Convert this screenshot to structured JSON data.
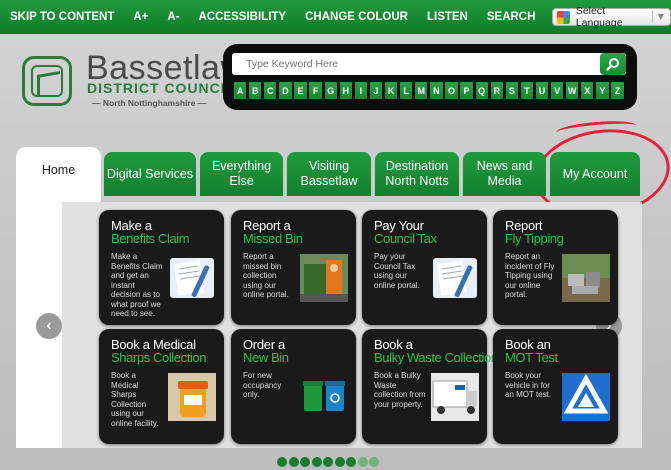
{
  "topbar": {
    "links": [
      "SKIP TO CONTENT",
      "A+",
      "A-",
      "ACCESSIBILITY",
      "CHANGE COLOUR",
      "LISTEN",
      "SEARCH"
    ],
    "language_label": "Select Language"
  },
  "logo": {
    "name": "Bassetlaw",
    "subtitle": "DISTRICT COUNCIL",
    "tagline": "— North Nottinghamshire —"
  },
  "search": {
    "placeholder": "Type Keyword Here",
    "letters": [
      "A",
      "B",
      "C",
      "D",
      "E",
      "F",
      "G",
      "H",
      "I",
      "J",
      "K",
      "L",
      "M",
      "N",
      "O",
      "P",
      "Q",
      "R",
      "S",
      "T",
      "U",
      "V",
      "W",
      "X",
      "Y",
      "Z"
    ]
  },
  "tabs": [
    "Home",
    "Digital Services",
    "Everything Else",
    "Visiting Bassetlaw",
    "Destination North Notts",
    "News and Media",
    "My Account"
  ],
  "cards": [
    {
      "t1": "Make a",
      "t2": "Benefits Claim",
      "desc": "Make a Benefits Claim and get an instant decision as to what proof we need to see.",
      "icon": "form-pen-icon"
    },
    {
      "t1": "Report a",
      "t2": "Missed Bin",
      "desc": "Report a missed bin collection using our online portal.",
      "icon": "bin-lorry-icon"
    },
    {
      "t1": "Pay Your",
      "t2": "Council Tax",
      "desc": "Pay your Council Tax using our online portal.",
      "icon": "form-pen-icon"
    },
    {
      "t1": "Report",
      "t2": "Fly Tipping",
      "desc": "Report an incident of Fly Tipping using our online portal.",
      "icon": "fly-tipping-icon"
    },
    {
      "t1": "Book a Medical",
      "t2": "Sharps Collection",
      "desc": "Book a Medical Sharps Collection using our online facility.",
      "icon": "sharps-bin-icon"
    },
    {
      "t1": "Order a",
      "t2": "New Bin",
      "desc": "For new occupancy only.",
      "icon": "wheelie-bins-icon"
    },
    {
      "t1": "Book a",
      "t2": "Bulky Waste Collection",
      "desc": "Book a Bulky Waste collection from your property.",
      "icon": "bulky-truck-icon"
    },
    {
      "t1": "Book an",
      "t2": "MOT Test",
      "desc": "Book your vehicle in for an MOT test.",
      "icon": "mot-triangle-icon"
    }
  ],
  "slider": {
    "total": 9,
    "active_count": 7
  },
  "colors": {
    "green": "#1a9138",
    "annotation": "#e0243a"
  }
}
